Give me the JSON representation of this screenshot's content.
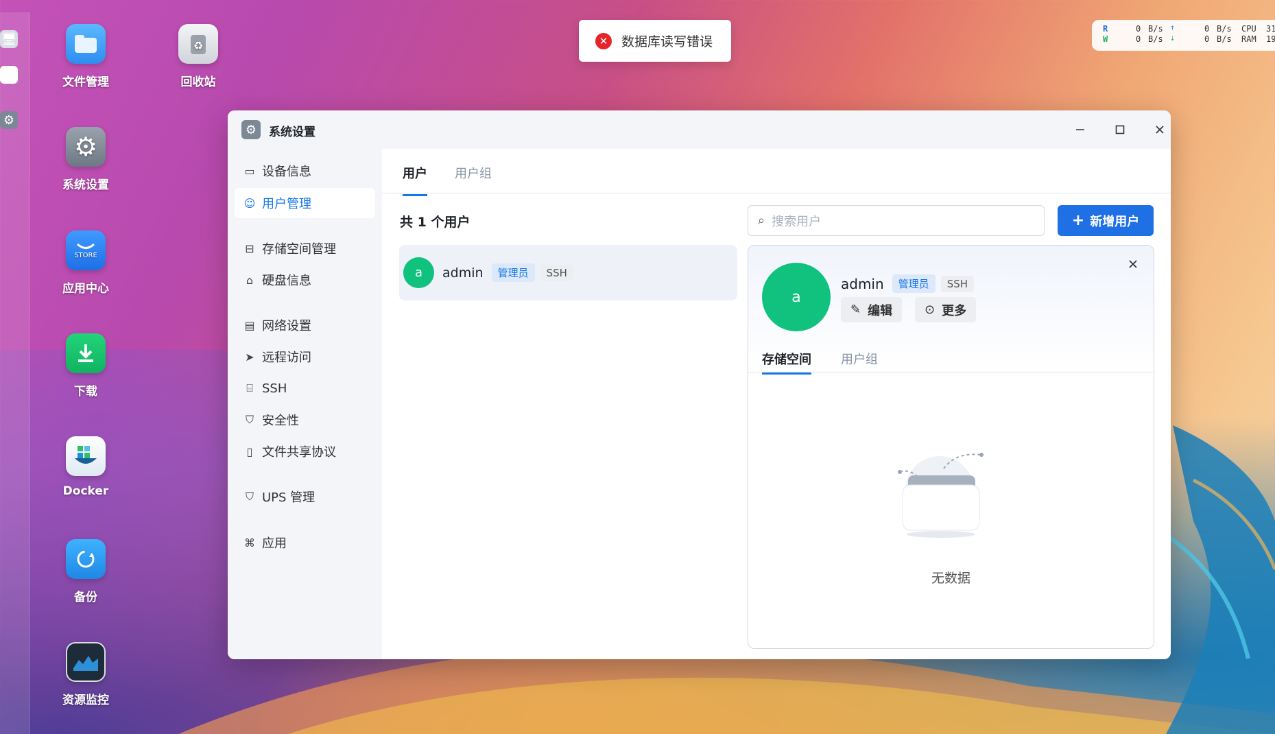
{
  "desktop": {
    "icons": [
      {
        "label": "文件管理",
        "icon": "folder-icon"
      },
      {
        "label": "回收站",
        "icon": "recycle-bin-icon"
      },
      {
        "label": "系统设置",
        "icon": "settings-gear-icon"
      },
      {
        "label": "应用中心",
        "icon": "store-icon",
        "sub": "STORE"
      },
      {
        "label": "下载",
        "icon": "download-icon"
      },
      {
        "label": "Docker",
        "icon": "docker-icon"
      },
      {
        "label": "备份",
        "icon": "backup-icon"
      },
      {
        "label": "资源监控",
        "icon": "resource-monitor-icon"
      }
    ]
  },
  "toast": {
    "message": "数据库读写错误",
    "icon": "error-icon"
  },
  "monitor": {
    "r_label": "R",
    "w_label": "W",
    "r_disk": "0",
    "w_disk": "0",
    "unit1": "B/s",
    "unit2": "B/s",
    "r_net": "0",
    "w_net": "0",
    "unit3": "B/s",
    "unit4": "B/s",
    "cpu_label": "CPU",
    "ram_label": "RAM",
    "cpu_val": "31",
    "ram_val": "19"
  },
  "window": {
    "title": "系统设置",
    "sidebar": [
      {
        "label": "设备信息",
        "icon": "device-info-icon"
      },
      {
        "label": "用户管理",
        "icon": "user-icon"
      },
      {
        "label": "存储空间管理",
        "icon": "storage-icon"
      },
      {
        "label": "硬盘信息",
        "icon": "disk-icon"
      },
      {
        "label": "网络设置",
        "icon": "network-icon"
      },
      {
        "label": "远程访问",
        "icon": "remote-access-icon"
      },
      {
        "label": "SSH",
        "icon": "ssh-icon"
      },
      {
        "label": "安全性",
        "icon": "security-shield-icon"
      },
      {
        "label": "文件共享协议",
        "icon": "file-share-icon"
      },
      {
        "label": "UPS 管理",
        "icon": "ups-icon"
      },
      {
        "label": "应用",
        "icon": "apps-icon"
      }
    ],
    "tabs": [
      "用户",
      "用户组"
    ],
    "count_text": "共 1 个用户",
    "search_placeholder": "搜索用户",
    "add_button": "新增用户",
    "users": [
      {
        "avatar": "a",
        "name": "admin",
        "badge_admin": "管理员",
        "badge_ssh": "SSH"
      }
    ],
    "detail": {
      "avatar": "a",
      "name": "admin",
      "badge_admin": "管理员",
      "badge_ssh": "SSH",
      "edit": "编辑",
      "more": "更多",
      "tabs": [
        "存储空间",
        "用户组"
      ],
      "empty": "无数据"
    }
  },
  "colors": {
    "accent": "#1677e5",
    "avatar": "#10c27e",
    "error": "#e5242b"
  }
}
